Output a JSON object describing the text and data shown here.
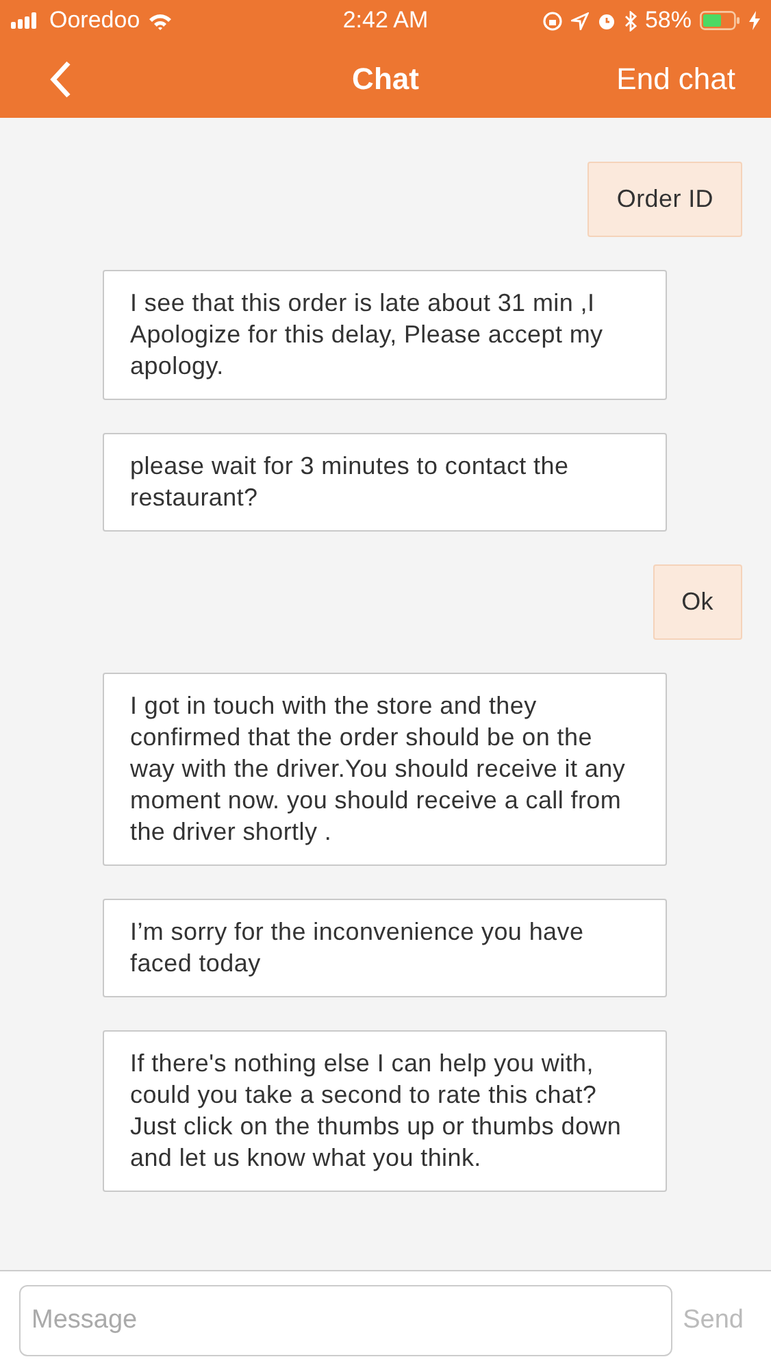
{
  "status_bar": {
    "carrier": "Ooredoo",
    "time": "2:42 AM",
    "battery": "58%"
  },
  "nav": {
    "title": "Chat",
    "action": "End chat"
  },
  "messages": [
    {
      "kind": "sent",
      "text": "Order ID"
    },
    {
      "kind": "received",
      "text": "I see that this order is late about 31 min ,I Apologize for this delay, Please accept my apology."
    },
    {
      "kind": "received",
      "text": "please wait for 3 minutes to contact the restaurant?"
    },
    {
      "kind": "sent",
      "text": "Ok"
    },
    {
      "kind": "received",
      "text": "I got in touch with the store and they confirmed that the order should be on the way with the driver.You should receive it any moment now. you should receive a call from the driver shortly ."
    },
    {
      "kind": "received",
      "text": "I’m sorry for the inconvenience you have faced today"
    },
    {
      "kind": "received",
      "text": "If there's nothing else I can help you with, could you take a second to rate this chat? Just click on the thumbs up or thumbs down and let us know what you think."
    }
  ],
  "composer": {
    "placeholder": "Message",
    "send": "Send"
  }
}
